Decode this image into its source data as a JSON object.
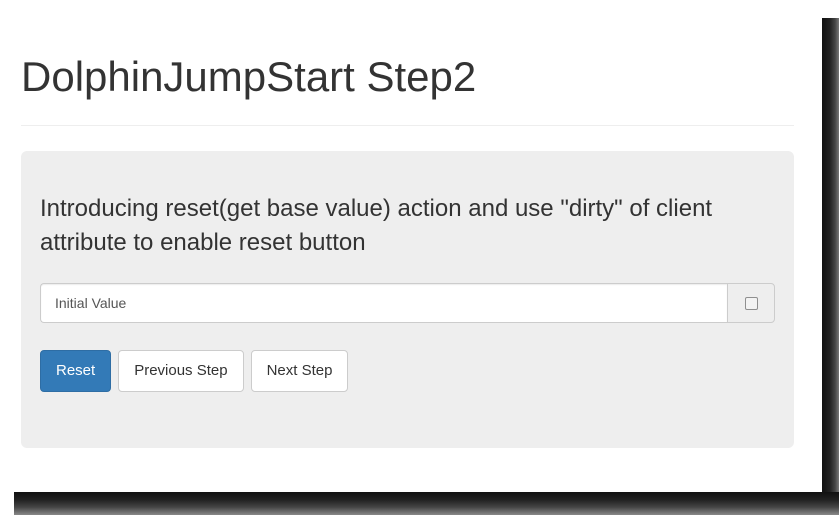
{
  "page": {
    "title": "DolphinJumpStart Step2"
  },
  "jumbotron": {
    "intro": "Introducing reset(get base value) action and use \"dirty\" of client attribute to enable reset button",
    "input": {
      "value": "Initial Value",
      "placeholder": ""
    },
    "dirty_checked": false,
    "buttons": {
      "reset": "Reset",
      "previous": "Previous Step",
      "next": "Next Step"
    }
  },
  "colors": {
    "primary": "#337ab7",
    "panel_bg": "#eeeeee",
    "text": "#333333"
  }
}
